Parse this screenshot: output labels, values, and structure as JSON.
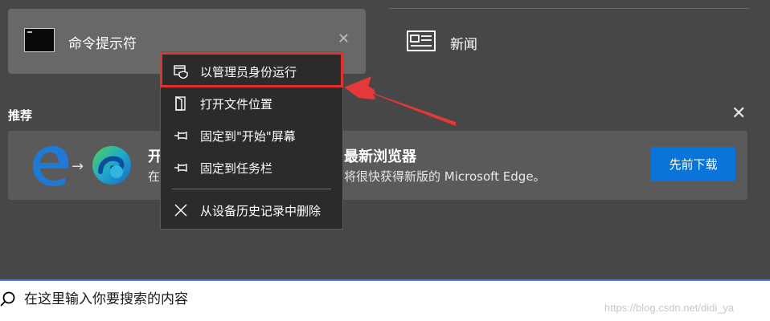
{
  "best_match": {
    "title": "命令提示符",
    "close_glyph": "✕",
    "icon": "cmd-icon"
  },
  "news": {
    "label": "新闻",
    "icon": "newspaper-icon"
  },
  "recommend": {
    "heading": "推荐",
    "close_glyph": "✕",
    "title_left": "开",
    "title_right": "最新浏览器",
    "desc_left": "在",
    "desc_right": "将很快获得新版的 Microsoft Edge。",
    "arrow_glyph": "→",
    "download_label": "先前下载"
  },
  "context_menu": {
    "items": [
      {
        "label": "以管理员身份运行",
        "icon": "shield-window-icon"
      },
      {
        "label": "打开文件位置",
        "icon": "folder-door-icon"
      },
      {
        "label": "固定到\"开始\"屏幕",
        "icon": "pin-icon"
      },
      {
        "label": "固定到任务栏",
        "icon": "pin-icon"
      },
      {
        "label": "从设备历史记录中删除",
        "icon": "close-icon"
      }
    ]
  },
  "search": {
    "placeholder": "在这里输入你要搜索的内容",
    "value": ""
  },
  "watermark": "https://blog.csdn.net/didi_ya",
  "colors": {
    "background": "#474747",
    "card": "#686868",
    "menu": "#2b2b2b",
    "accent_button": "#0a74d8",
    "highlight": "#e03232"
  }
}
